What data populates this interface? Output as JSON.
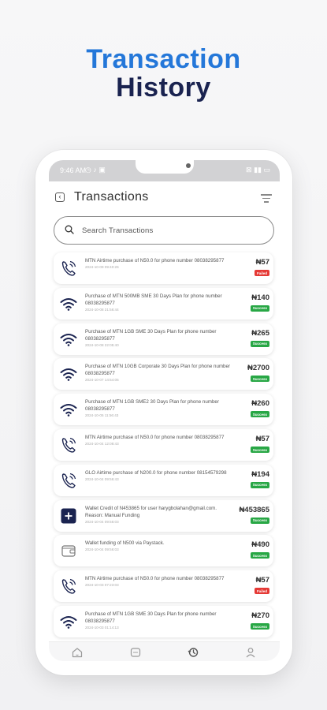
{
  "headline": {
    "line1": "Transaction",
    "line2": "History"
  },
  "status": {
    "time": "9:46 AM",
    "left_icons": "◷ ♪ ▣",
    "right_icons": "⊠ ▮▮ ▭"
  },
  "appbar": {
    "title": "Transactions"
  },
  "search": {
    "placeholder": "Search Transactions"
  },
  "transactions": [
    {
      "icon": "phone-icon",
      "description": "MTN Airtime purchase of N50.0 for phone number 08038295877",
      "date": "2024-10-09 09:40:26",
      "amount": "₦57",
      "status": "Failed"
    },
    {
      "icon": "wifi-icon",
      "description": "Purchase of MTN 500MB SME 30 Days Plan for phone number 08038295877",
      "date": "2024-10-08 21:56:44",
      "amount": "₦140",
      "status": "Success"
    },
    {
      "icon": "wifi-icon",
      "description": "Purchase of MTN 1GB SME 30 Days Plan for phone number 08038295877",
      "date": "2024-10-08 22:05:40",
      "amount": "₦265",
      "status": "Success"
    },
    {
      "icon": "wifi-icon",
      "description": "Purchase of MTN 10GB Corporate 30 Days Plan for phone number 08038295877",
      "date": "2024-10-07 14:54:05",
      "amount": "₦2700",
      "status": "Success"
    },
    {
      "icon": "wifi-icon",
      "description": "Purchase of MTN 1GB SME2 30 Days Plan for phone number 08038295877",
      "date": "2024-10-05 11:56:43",
      "amount": "₦260",
      "status": "Success"
    },
    {
      "icon": "phone-icon",
      "description": "MTN Airtime purchase of N50.0 for phone number 08038295877",
      "date": "2024-10-04 12:08:43",
      "amount": "₦57",
      "status": "Success"
    },
    {
      "icon": "phone-icon",
      "description": "GLO Airtime purchase of N200.0 for phone number 08154579298",
      "date": "2024-10-04 09:56:43",
      "amount": "₦194",
      "status": "Success"
    },
    {
      "icon": "plus-icon",
      "description": "Wallet Credit of N453865 for user harygbolahan@gmail.com. Reason: Manual Funding",
      "date": "2024-10-04 09:56:03",
      "amount": "₦453865",
      "status": "Success"
    },
    {
      "icon": "wallet-icon",
      "description": "Wallet funding of N500 via Paystack.",
      "date": "2024-10-04 09:56:03",
      "amount": "₦490",
      "status": "Success"
    },
    {
      "icon": "phone-icon",
      "description": "MTN Airtime purchase of N50.0 for phone number 08038295877",
      "date": "2024-10-03 07:23:03",
      "amount": "₦57",
      "status": "Failed"
    },
    {
      "icon": "wifi-icon",
      "description": "Purchase of MTN 1GB SME 30 Days Plan for phone number 08038295877",
      "date": "2024-10-03 01:14:13",
      "amount": "₦270",
      "status": "Success"
    }
  ],
  "bottom_nav": [
    {
      "name": "home-icon"
    },
    {
      "name": "services-icon"
    },
    {
      "name": "history-icon"
    },
    {
      "name": "profile-icon"
    }
  ],
  "colors": {
    "accent_blue": "#2477d9",
    "navy": "#1a2350",
    "success": "#28a745",
    "failed": "#e53935"
  }
}
